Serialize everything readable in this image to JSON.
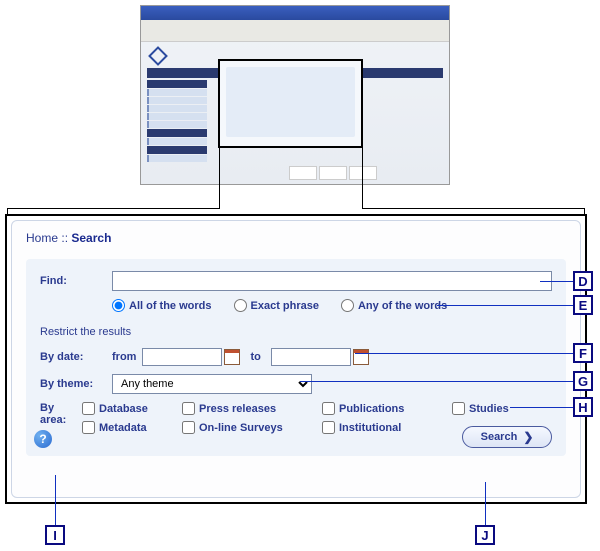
{
  "breadcrumb": {
    "home": "Home",
    "sep": "::",
    "current": "Search"
  },
  "find": {
    "label": "Find:",
    "value": ""
  },
  "match_modes": {
    "all": "All of the words",
    "exact": "Exact phrase",
    "any": "Any of the words"
  },
  "restrict_heading": "Restrict the results",
  "by_date": {
    "label": "By date:",
    "from": "from",
    "to": "to",
    "from_value": "",
    "to_value": ""
  },
  "by_theme": {
    "label": "By theme:",
    "selected": "Any theme"
  },
  "by_area": {
    "label": "By area:",
    "options": {
      "database": "Database",
      "press": "Press releases",
      "publications": "Publications",
      "studies": "Studies",
      "metadata": "Metadata",
      "surveys": "On-line Surveys",
      "institutional": "Institutional"
    }
  },
  "help_icon": "?",
  "search_button": "Search",
  "callouts": {
    "D": "D",
    "E": "E",
    "F": "F",
    "G": "G",
    "H": "H",
    "I": "I",
    "J": "J"
  }
}
